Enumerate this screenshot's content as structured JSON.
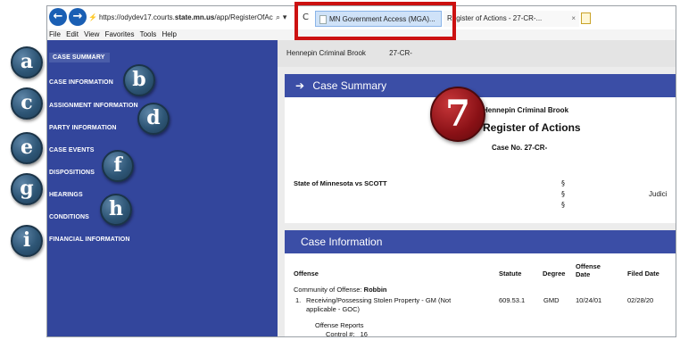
{
  "browser": {
    "url_prefix": "https://odydev17.courts.",
    "url_domain": "state.mn.us",
    "url_suffix": "/app/RegisterOfAc",
    "url_controls": "⌕ ▾",
    "refresh_icon": "C",
    "active_tab": "MN Government Access (MGA)...",
    "inactive_tab": "Register of Actions - 27-CR-...",
    "inactive_tab_close": "×"
  },
  "menu": [
    "File",
    "Edit",
    "View",
    "Favorites",
    "Tools",
    "Help"
  ],
  "sidebar": {
    "items": [
      {
        "label": "CASE SUMMARY",
        "active": true
      },
      {
        "label": "CASE INFORMATION"
      },
      {
        "label": "ASSIGNMENT INFORMATION"
      },
      {
        "label": "PARTY INFORMATION"
      },
      {
        "label": "CASE EVENTS"
      },
      {
        "label": "DISPOSITIONS"
      },
      {
        "label": "HEARINGS"
      },
      {
        "label": "CONDITIONS"
      },
      {
        "label": "FINANCIAL INFORMATION"
      }
    ]
  },
  "badges": [
    "a",
    "b",
    "c",
    "d",
    "e",
    "f",
    "g",
    "h",
    "i"
  ],
  "step_badge": "7",
  "breadcrumb": {
    "court": "Hennepin Criminal Brook",
    "case": "27-CR-"
  },
  "case_summary": {
    "arrow": "➔",
    "heading": "Case Summary",
    "court": "Hennepin Criminal Brook",
    "title": "Register of Actions",
    "case_no": "Case No. 27-CR-",
    "party": "State of Minnesota vs SCOTT",
    "section_mark": "§",
    "judicial": "Judici"
  },
  "case_information": {
    "heading": "Case Information",
    "columns": {
      "offense": "Offense",
      "statute": "Statute",
      "degree": "Degree",
      "offense_date": "Offense Date",
      "filed_date": "Filed Date"
    },
    "community_label": "Community of Offense:",
    "community": "Robbin",
    "row": {
      "number": "1.",
      "offense_line1": "Receiving/Possessing Stolen Property - GM (Not",
      "offense_line2": "applicable - GOC)",
      "statute": "609.53.1",
      "degree": "GMD",
      "offense_date": "10/24/01",
      "filed_date": "02/28/20"
    },
    "reports_label": "Offense Reports",
    "control_label": "Control #:",
    "control_value": "16"
  },
  "colors": {
    "sidebar": "#33469c",
    "panel_header": "#3b4ea6",
    "badge": "#2e5676",
    "step_badge": "#8a1116",
    "highlight": "#cc1111",
    "nav_button": "#1a5fb4"
  }
}
